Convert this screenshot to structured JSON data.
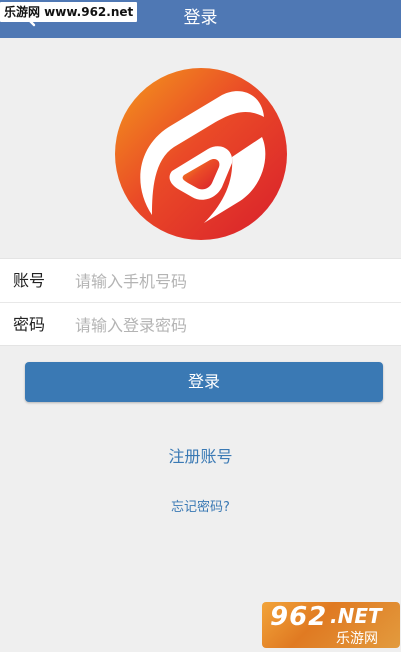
{
  "header": {
    "title": "登录",
    "color": "#4f78b4"
  },
  "watermark_top": "乐游网 www.962.net",
  "logo": {
    "colors": [
      "#f08a1c",
      "#e8432a",
      "#d91f2b"
    ]
  },
  "form": {
    "account_label": "账号",
    "account_placeholder": "请输入手机号码",
    "password_label": "密码",
    "password_placeholder": "请输入登录密码"
  },
  "login_button": {
    "label": "登录",
    "color": "#3a79b4"
  },
  "register_link": "注册账号",
  "forgot_link": "忘记密码?",
  "watermark_bottom": {
    "big": "962",
    "net": ".NET",
    "small": "乐游网"
  }
}
